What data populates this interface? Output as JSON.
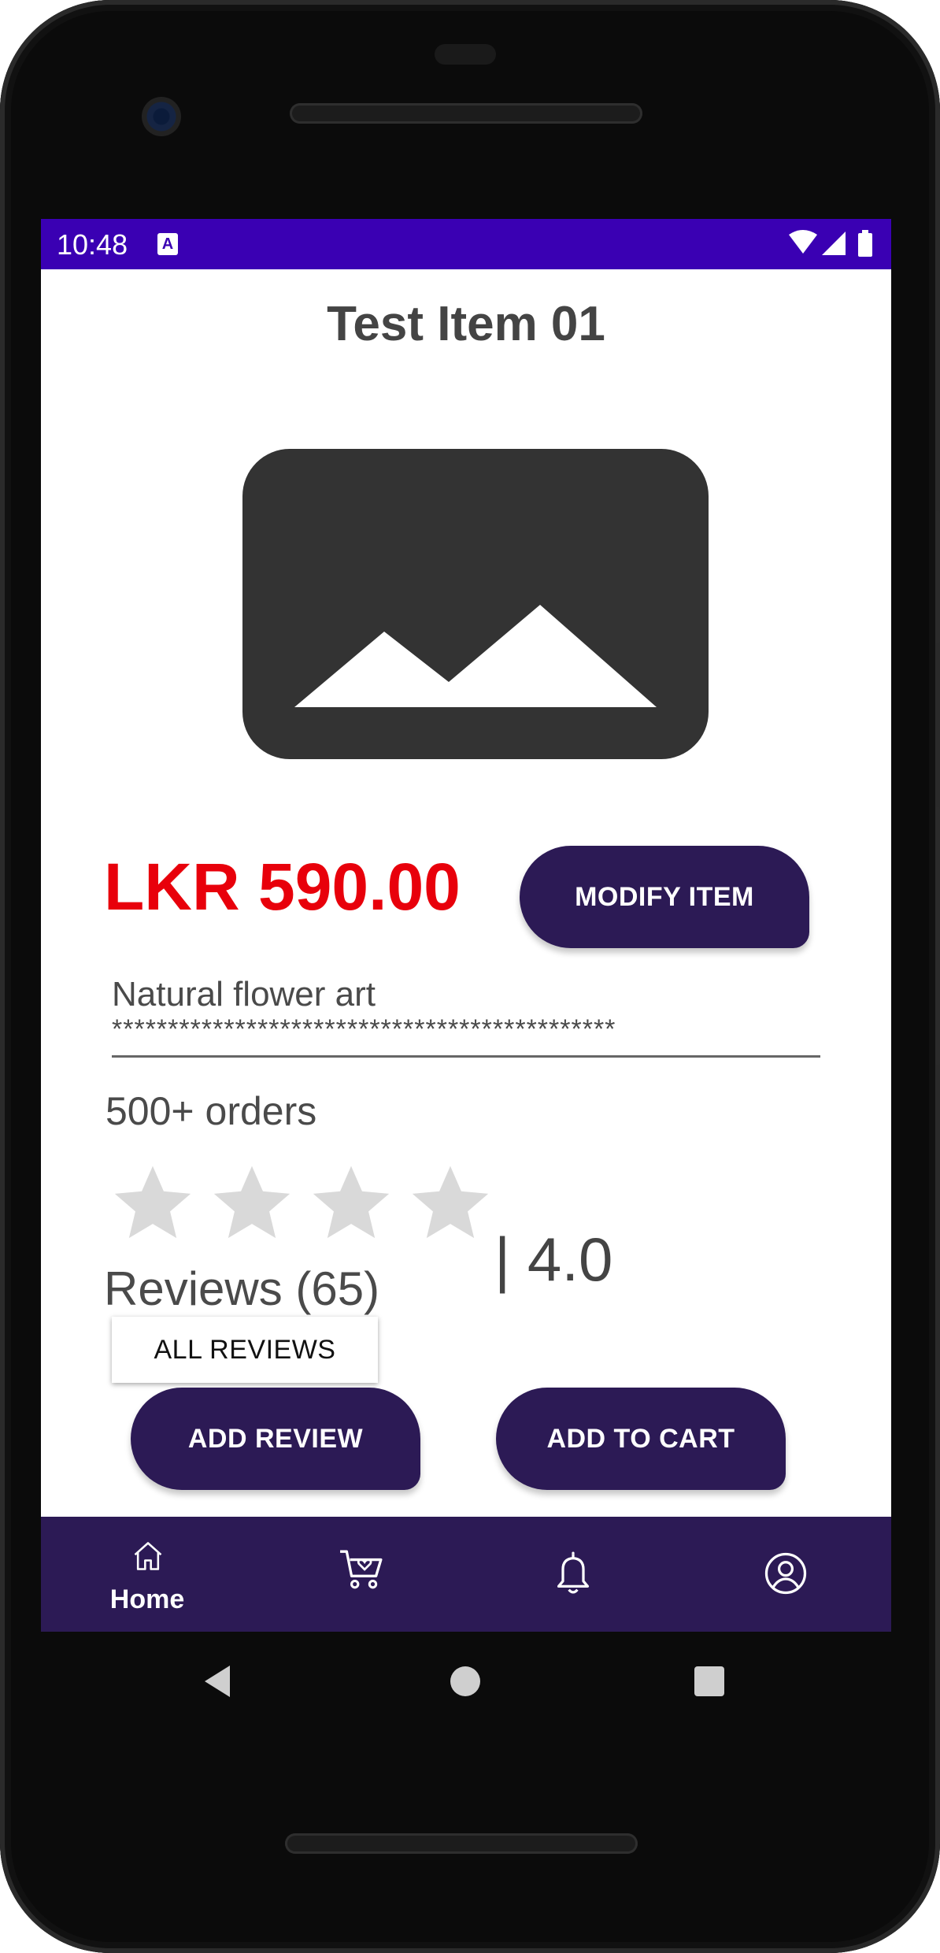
{
  "status_bar": {
    "time": "10:48",
    "app_badge": "A"
  },
  "product": {
    "title": "Test Item 01",
    "price": "LKR 590.00",
    "description": "Natural flower art",
    "description_mask": "*********************************************",
    "orders": "500+ orders",
    "rating_text": "| 4.0",
    "rating_value": 4,
    "rating_max": 4,
    "reviews": "Reviews (65)"
  },
  "buttons": {
    "modify": "MODIFY ITEM",
    "all_reviews": "ALL REVIEWS",
    "add_review": "ADD REVIEW",
    "add_to_cart": "ADD TO CART"
  },
  "bottom_nav": {
    "items": [
      {
        "icon": "home-icon",
        "label": "Home",
        "active": true
      },
      {
        "icon": "cart-icon",
        "label": ""
      },
      {
        "icon": "bell-icon",
        "label": ""
      },
      {
        "icon": "profile-icon",
        "label": ""
      }
    ]
  },
  "colors": {
    "status_bar": "#3a00b3",
    "primary": "#2c1a55",
    "price": "#e8000b",
    "text": "#4a4a4a"
  }
}
